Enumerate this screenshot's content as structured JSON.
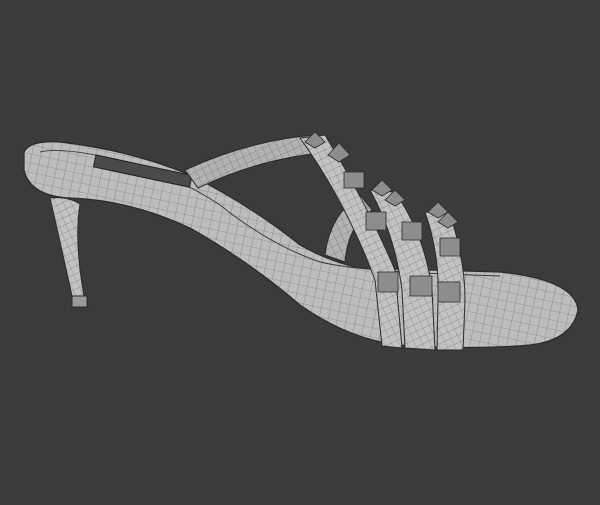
{
  "scene": {
    "subject": "sandal-model",
    "colors": {
      "background": "#3b3b3b",
      "surface": "#b9b9b9",
      "wire": "#5a5a5a",
      "outline": "#2a2a2a"
    }
  }
}
